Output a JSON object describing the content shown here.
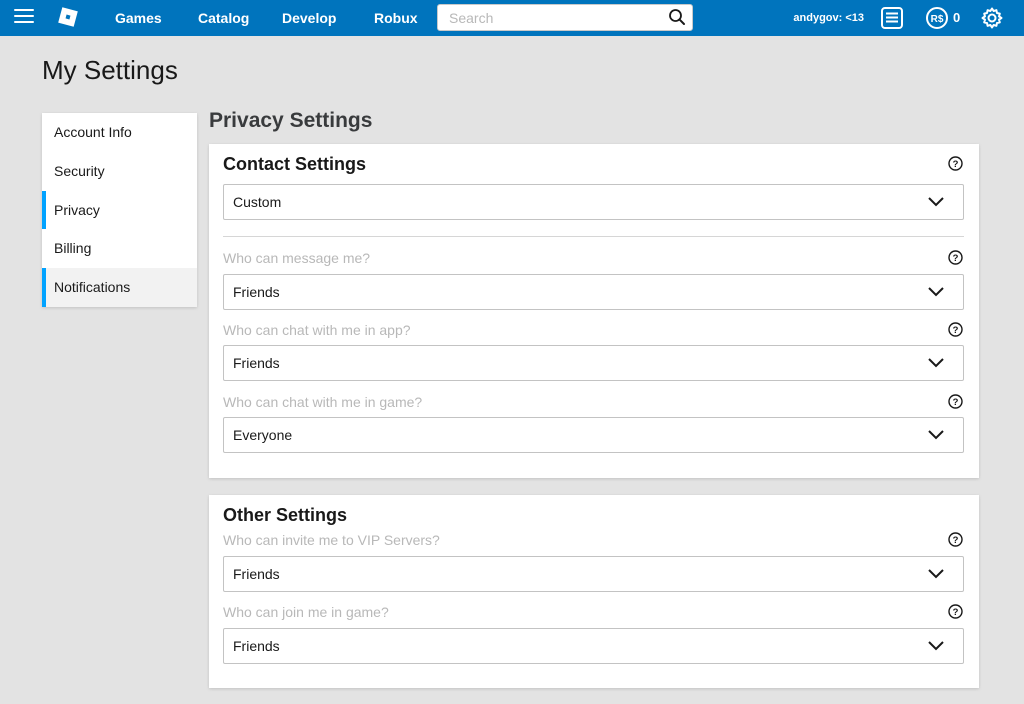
{
  "nav": {
    "links": [
      "Games",
      "Catalog",
      "Develop",
      "Robux"
    ],
    "search_placeholder": "Search",
    "username": "andygov: <13",
    "robux_count": "0"
  },
  "page_title": "My Settings",
  "menu": {
    "items": [
      "Account Info",
      "Security",
      "Privacy",
      "Billing",
      "Notifications"
    ],
    "active": "Privacy"
  },
  "section_heading": "Privacy Settings",
  "contact": {
    "title": "Contact Settings",
    "preset_value": "Custom",
    "fields": [
      {
        "label": "Who can message me?",
        "value": "Friends"
      },
      {
        "label": "Who can chat with me in app?",
        "value": "Friends"
      },
      {
        "label": "Who can chat with me in game?",
        "value": "Everyone"
      }
    ]
  },
  "other": {
    "title": "Other Settings",
    "fields": [
      {
        "label": "Who can invite me to VIP Servers?",
        "value": "Friends"
      },
      {
        "label": "Who can join me in game?",
        "value": "Friends"
      }
    ]
  },
  "colors": {
    "nav_bg": "#0074bd",
    "accent": "#00a2ff",
    "page_bg": "#e3e3e3",
    "muted_label": "#b8b8b8"
  },
  "icons": [
    "menu-icon",
    "roblox-logo-icon",
    "search-icon",
    "messages-icon",
    "robux-icon",
    "gear-icon",
    "help-icon",
    "chevron-down-icon"
  ]
}
